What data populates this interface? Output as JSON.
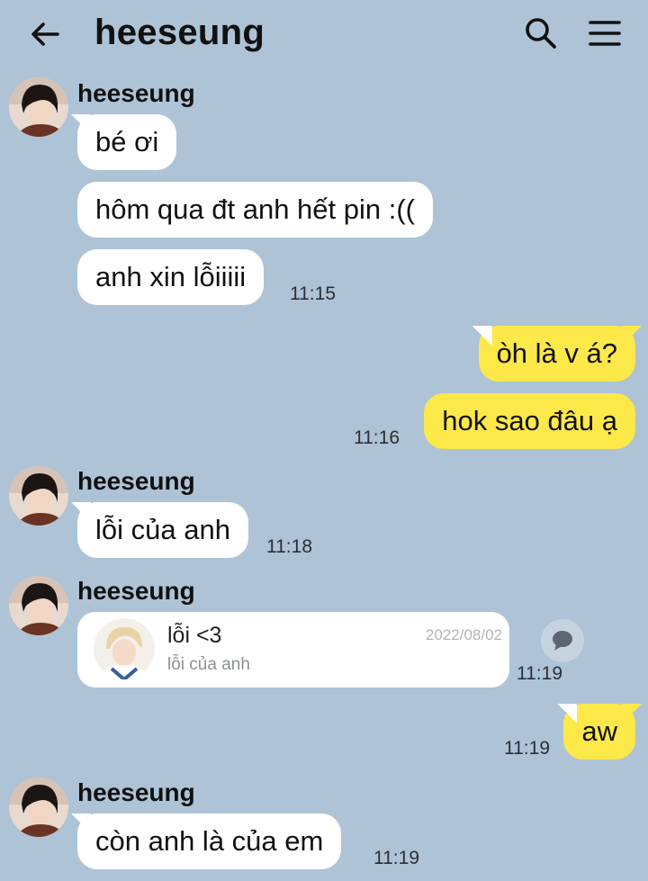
{
  "header": {
    "title": "heeseung",
    "back_icon": "arrow-left-icon",
    "search_icon": "search-icon",
    "menu_icon": "menu-icon"
  },
  "colors": {
    "background": "#aec3d6",
    "incoming_bubble": "#ffffff",
    "outgoing_bubble": "#fde84a"
  },
  "messages": [
    {
      "sender": "heeseung",
      "text": "bé ơi"
    },
    {
      "text": "hôm qua đt anh hết pin :(("
    },
    {
      "text": "anh xin lỗiiiii",
      "time": "11:15"
    },
    {
      "mine": true,
      "text": "òh là v á?"
    },
    {
      "mine": true,
      "text": "hok sao đâu ạ",
      "time": "11:16"
    },
    {
      "sender": "heeseung",
      "text": "lỗi của anh",
      "time": "11:18"
    },
    {
      "sender": "heeseung",
      "card": {
        "title": "lỗi <3",
        "subtitle": "lỗi của anh",
        "date": "2022/08/02"
      },
      "time": "11:19"
    },
    {
      "mine": true,
      "text": "aw",
      "time": "11:19"
    },
    {
      "sender": "heeseung",
      "text": "còn anh là của em",
      "time": "11:19"
    }
  ]
}
